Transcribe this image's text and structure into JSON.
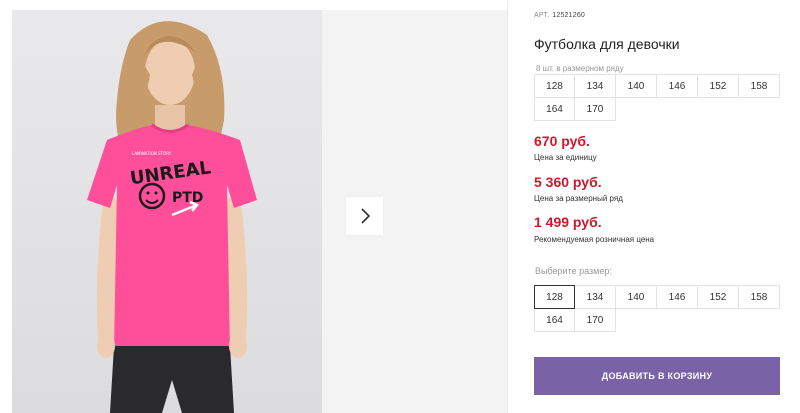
{
  "product": {
    "article_label": "АРТ.",
    "article_number": "12521260",
    "title": "Футболка для девочки",
    "image_alt": "Девочка в розовой футболке"
  },
  "pack": {
    "note": "8 шт. в размерном ряду",
    "sizes": [
      "128",
      "134",
      "140",
      "146",
      "152",
      "158",
      "164",
      "170"
    ]
  },
  "prices": {
    "unit_value": "670 руб.",
    "unit_caption": "Цена за единицу",
    "pack_value": "5 360 руб.",
    "pack_caption": "Цена за размерный ряд",
    "retail_value": "1 499 руб.",
    "retail_caption": "Рекомендуемая розничная цена"
  },
  "size_select": {
    "label": "Выберите размер:",
    "selected": "128",
    "sizes": [
      "128",
      "134",
      "140",
      "146",
      "152",
      "158",
      "164",
      "170"
    ]
  },
  "actions": {
    "add_to_cart": "ДОБАВИТЬ В КОРЗИНУ"
  },
  "colors": {
    "price": "#d0182b",
    "button": "#7a62a6",
    "shirt": "#ff4f9a"
  }
}
